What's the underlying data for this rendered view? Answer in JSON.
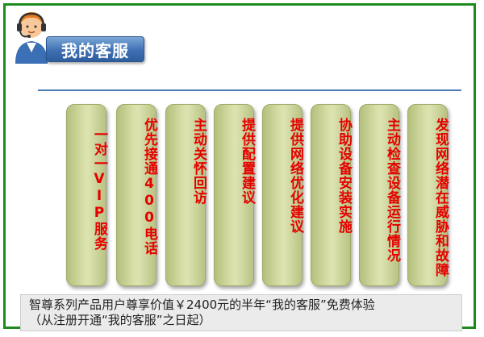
{
  "header": {
    "title": "我的客服",
    "avatar_icon": "customer-service-agent-icon"
  },
  "cards": [
    {
      "label": "一对一VIP服务"
    },
    {
      "label": "优先接通400电话"
    },
    {
      "label": "主动关怀回访"
    },
    {
      "label": "提供配置建议"
    },
    {
      "label": "提供网络优化建议"
    },
    {
      "label": "协助设备安装实施"
    },
    {
      "label": "主动检查设备运行情况"
    },
    {
      "label": "发现网络潜在威胁和故障"
    }
  ],
  "footer": {
    "line1": "智尊系列产品用户尊享价值￥2400元的半年“我的客服”免费体验",
    "line2": "（从注册开通“我的客服”之日起）"
  },
  "colors": {
    "frame_border": "#1f8a1f",
    "title_bg": "#3f70b3",
    "card_text": "#e60000",
    "card_bg": "#d9e0aa"
  }
}
